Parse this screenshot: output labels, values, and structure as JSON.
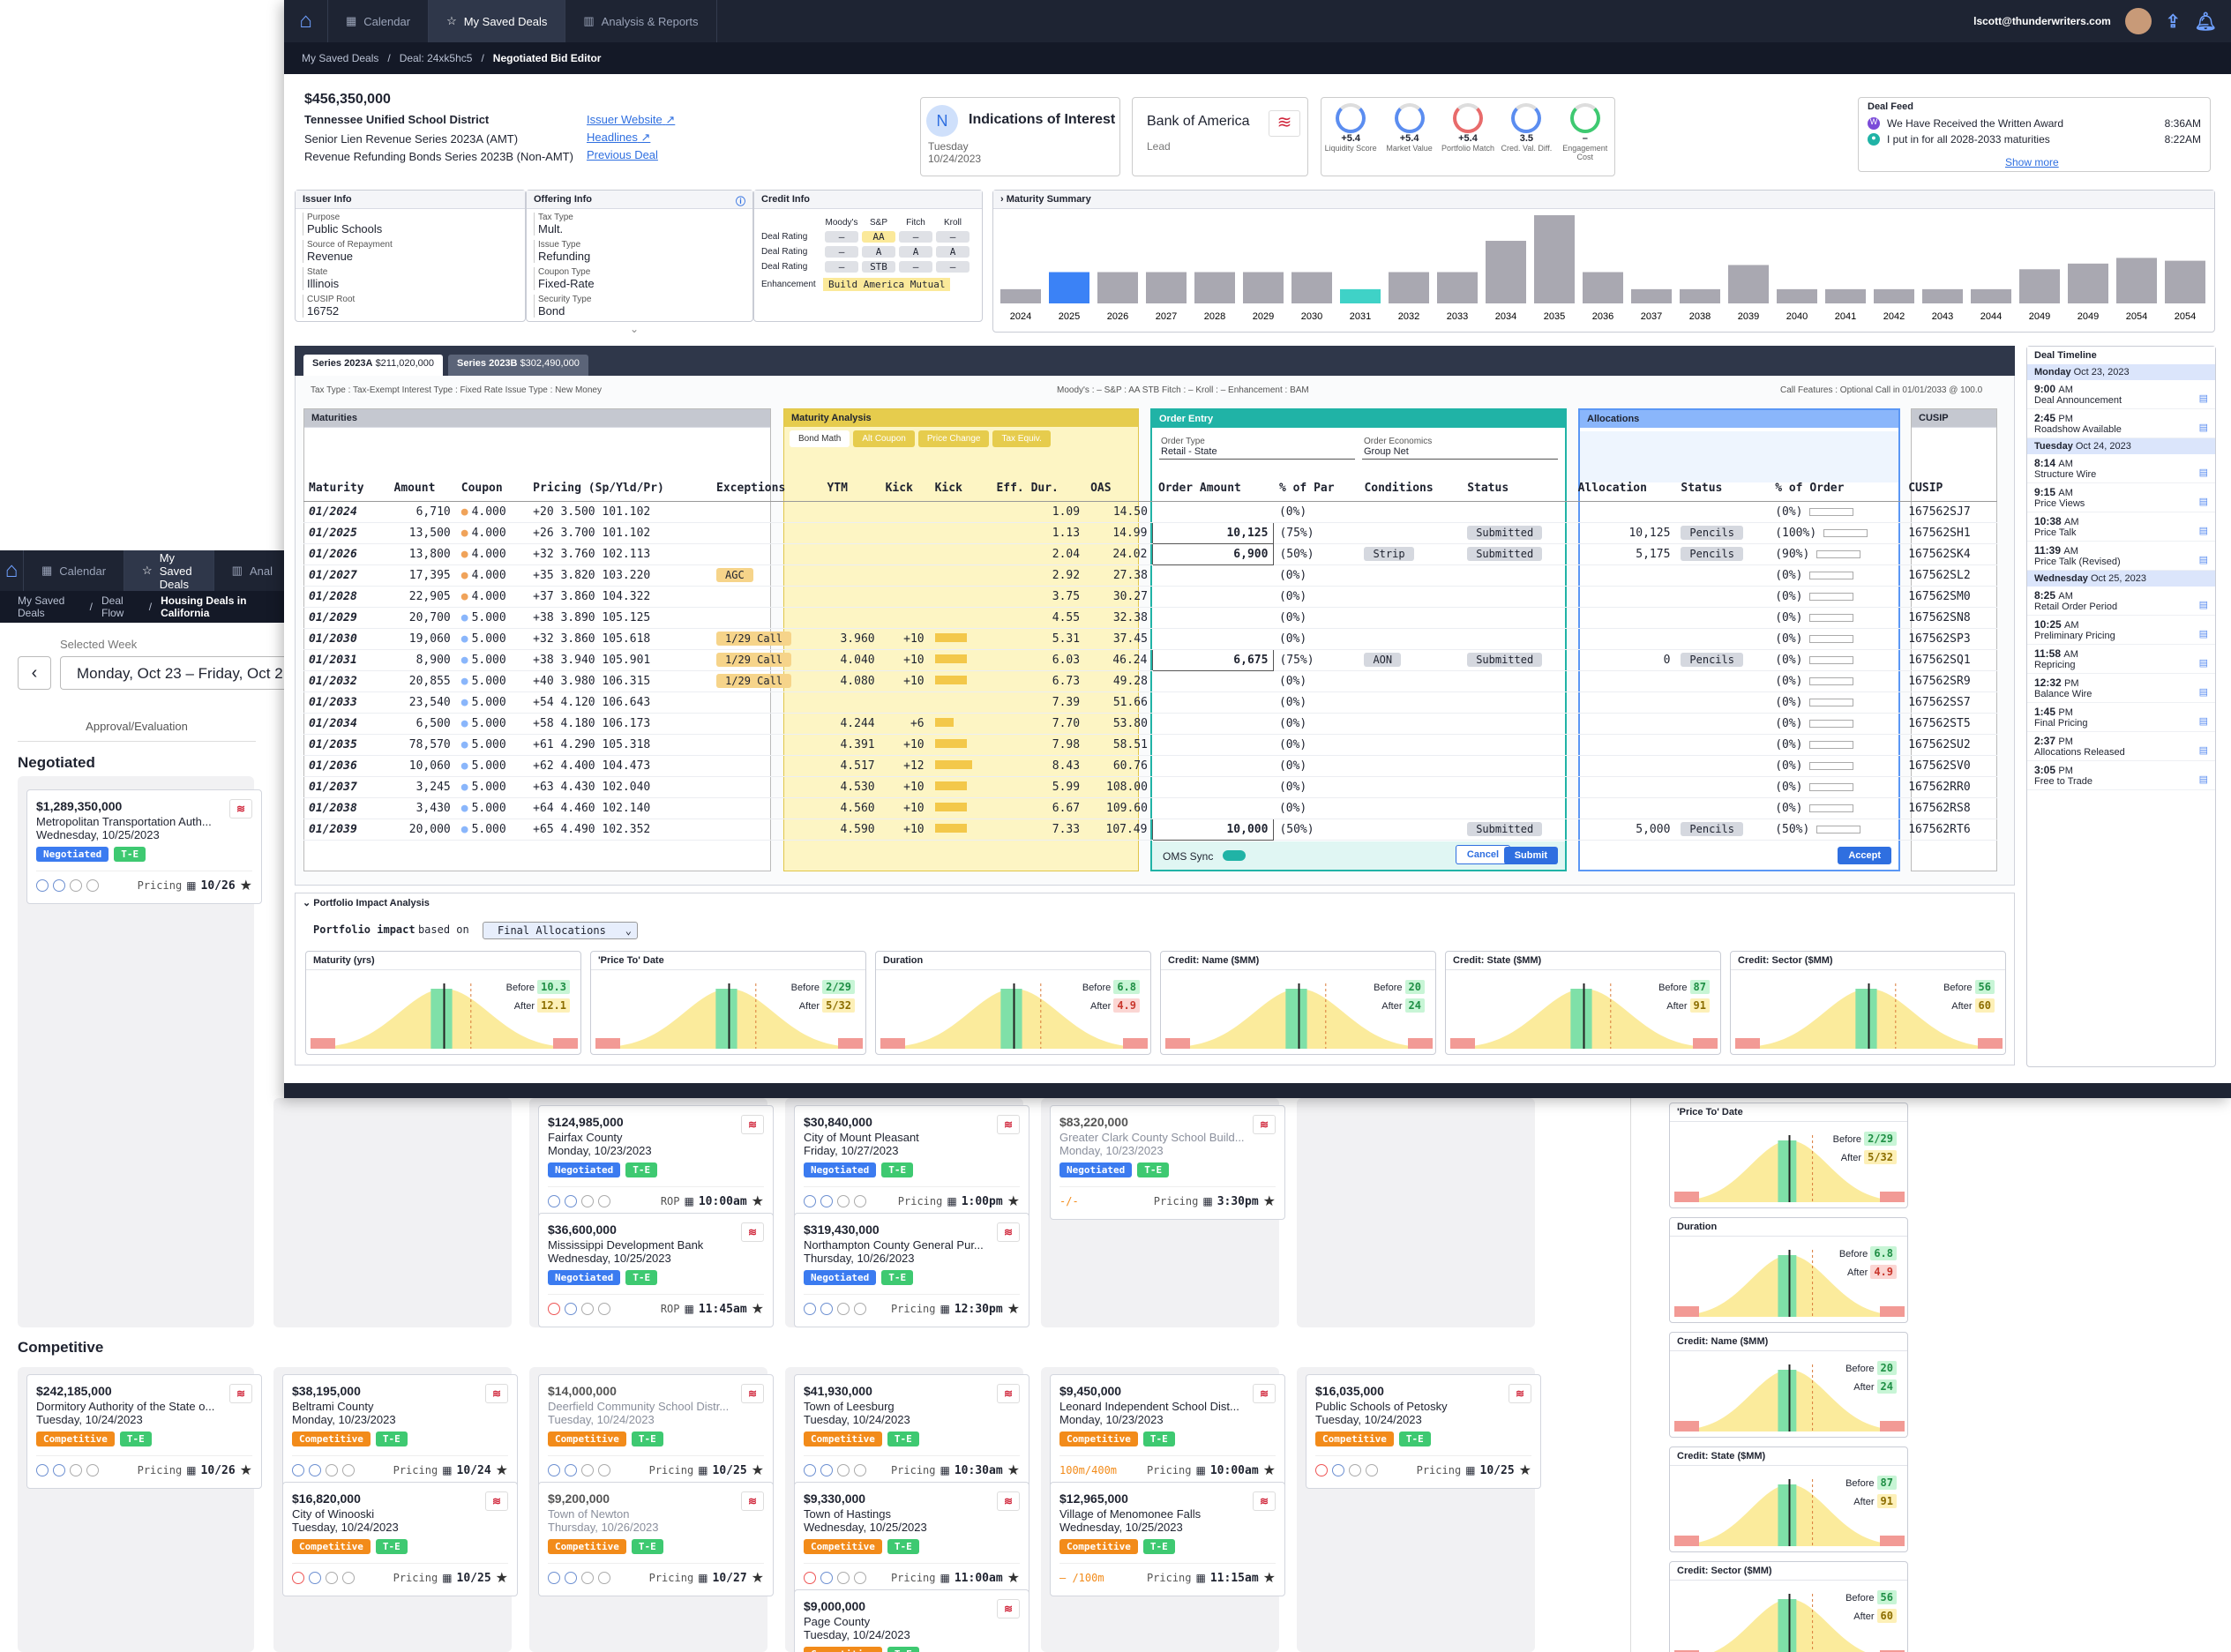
{
  "front": {
    "nav": {
      "tabs": [
        "Calendar",
        "My Saved Deals",
        "Analysis & Reports"
      ],
      "user": "lscott@thunderwriters.com"
    },
    "breadcrumb": [
      "My Saved Deals",
      "Deal: 24xk5hc5",
      "Negotiated Bid Editor"
    ],
    "deal": {
      "amount": "$456,350,000",
      "issuer": "Tennessee Unified School District",
      "series1": "Senior Lien Revenue Series 2023A (AMT)",
      "series2": "Revenue Refunding Bonds Series 2023B (Non-AMT)",
      "links": [
        "Issuer Website",
        "Headlines",
        "Previous Deal"
      ]
    },
    "ioi": {
      "letter": "N",
      "title": "Indications of Interest",
      "day": "Tuesday",
      "date": "10/24/2023"
    },
    "bank": {
      "name": "Bank of America",
      "role": "Lead"
    },
    "scores": [
      {
        "v": "+5.4",
        "l": "Liquidity Score"
      },
      {
        "v": "+5.4",
        "l": "Market Value"
      },
      {
        "v": "+5.4",
        "l": "Portfolio Match"
      },
      {
        "v": "3.5",
        "l": "Cred. Val. Diff."
      },
      {
        "v": "–",
        "l": "Engagement Cost"
      }
    ],
    "feed": {
      "title": "Deal Feed",
      "items": [
        {
          "t": "We Have Received the Written Award",
          "time": "8:36AM"
        },
        {
          "t": "I put in for all 2028-2033 maturities",
          "time": "8:22AM"
        }
      ],
      "more": "Show more"
    },
    "issuer_info": {
      "title": "Issuer Info",
      "fields": [
        {
          "k": "Purpose",
          "v": "Public Schools"
        },
        {
          "k": "Source of Repayment",
          "v": "Revenue"
        },
        {
          "k": "State",
          "v": "Illinois"
        },
        {
          "k": "CUSIP Root",
          "v": "16752"
        }
      ]
    },
    "offering_info": {
      "title": "Offering Info",
      "fields": [
        {
          "k": "Tax Type",
          "v": "Mult."
        },
        {
          "k": "Issue Type",
          "v": "Refunding"
        },
        {
          "k": "Coupon Type",
          "v": "Fixed-Rate"
        },
        {
          "k": "Security Type",
          "v": "Bond"
        }
      ]
    },
    "credit_info": {
      "title": "Credit Info",
      "cols": [
        "Moody's",
        "S&P",
        "Fitch",
        "Kroll"
      ],
      "rows": [
        {
          "l": "Deal Rating",
          "v": [
            "–",
            "AA",
            "–",
            "–"
          ]
        },
        {
          "l": "Deal Rating",
          "v": [
            "–",
            "A",
            "A",
            "A"
          ]
        },
        {
          "l": "Deal Rating",
          "v": [
            "–",
            "STB",
            "–",
            "–"
          ]
        }
      ],
      "enh_label": "Enhancement",
      "enh": "Build America Mutual"
    },
    "maturity_summary": {
      "title": "Maturity Summary",
      "years": [
        "2024",
        "2025",
        "2026",
        "2027",
        "2028",
        "2029",
        "2030",
        "2031",
        "2032",
        "2033",
        "2034",
        "2035",
        "2036",
        "2037",
        "2038",
        "2039",
        "2040",
        "2041",
        "2042",
        "2043",
        "2044",
        "2049",
        "2049",
        "2054",
        "2054"
      ],
      "values": [
        10,
        22,
        22,
        22,
        22,
        22,
        22,
        10,
        22,
        22,
        44,
        62,
        22,
        10,
        10,
        27,
        10,
        10,
        10,
        10,
        10,
        24,
        28,
        32,
        30
      ]
    },
    "series_tabs": [
      {
        "n": "Series 2023A",
        "a": "$211,020,000"
      },
      {
        "n": "Series 2023B",
        "a": "$302,490,000"
      }
    ],
    "series_meta": "Tax Type : Tax-Exempt   Interest Type : Fixed Rate   Issue Type : New Money",
    "series_meta2": "Moody's : –   S&P : AA STB   Fitch : –   Kroll : –   Enhancement : BAM",
    "call_features": "Call Features : Optional Call in 01/01/2033 @ 100.0",
    "sections": {
      "maturities": "Maturities",
      "analysis": "Maturity Analysis",
      "order": "Order Entry",
      "alloc": "Allocations",
      "cusip": "CUSIP"
    },
    "analysis_tabs": [
      "Bond Math",
      "Alt Coupon",
      "Price Change",
      "Tax Equiv."
    ],
    "order_type": {
      "label": "Order Type",
      "value": "Retail - State"
    },
    "order_econ": {
      "label": "Order Economics",
      "value": "Group Net"
    },
    "headers": [
      "Maturity",
      "Amount",
      "Coupon",
      "Pricing (Sp/Yld/Pr)",
      "Exceptions",
      "YTM",
      "Kick",
      "Kick",
      "Eff. Dur.",
      "OAS",
      "Order Amount",
      "% of Par",
      "Conditions",
      "Status",
      "Allocation",
      "Status",
      "% of Order",
      "CUSIP"
    ],
    "rows": [
      [
        "01/2024",
        "6,710",
        "4.000",
        "+20",
        "3.500",
        "101.102",
        "",
        "",
        "",
        "1.09",
        "14.50",
        "",
        "(0%)",
        "",
        "",
        "",
        "",
        "(0%)",
        "167562SJ7"
      ],
      [
        "01/2025",
        "13,500",
        "4.000",
        "+26",
        "3.700",
        "101.102",
        "",
        "",
        "",
        "1.13",
        "14.99",
        "10,125",
        "(75%)",
        "",
        "Submitted",
        "10,125",
        "Pencils",
        "(100%)",
        "167562SH1"
      ],
      [
        "01/2026",
        "13,800",
        "4.000",
        "+32",
        "3.760",
        "102.113",
        "",
        "",
        "",
        "2.04",
        "24.02",
        "6,900",
        "(50%)",
        "Strip",
        "Submitted",
        "5,175",
        "Pencils",
        "(90%)",
        "167562SK4"
      ],
      [
        "01/2027",
        "17,395",
        "4.000",
        "+35",
        "3.820",
        "103.220",
        "AGC",
        "",
        "",
        "2.92",
        "27.38",
        "",
        "(0%)",
        "",
        "",
        "",
        "",
        "(0%)",
        "167562SL2"
      ],
      [
        "01/2028",
        "22,905",
        "4.000",
        "+37",
        "3.860",
        "104.322",
        "",
        "",
        "",
        "3.75",
        "30.27",
        "",
        "(0%)",
        "",
        "",
        "",
        "",
        "(0%)",
        "167562SM0"
      ],
      [
        "01/2029",
        "20,700",
        "5.000",
        "+38",
        "3.890",
        "105.125",
        "",
        "",
        "",
        "4.55",
        "32.38",
        "",
        "(0%)",
        "",
        "",
        "",
        "",
        "(0%)",
        "167562SN8"
      ],
      [
        "01/2030",
        "19,060",
        "5.000",
        "+32",
        "3.860",
        "105.618",
        "1/29 Call",
        "3.960",
        "+10",
        "5.31",
        "37.45",
        "",
        "(0%)",
        "",
        "",
        "",
        "",
        "(0%)",
        "167562SP3"
      ],
      [
        "01/2031",
        "8,900",
        "5.000",
        "+38",
        "3.940",
        "105.901",
        "1/29 Call",
        "4.040",
        "+10",
        "6.03",
        "46.24",
        "6,675",
        "(75%)",
        "AON",
        "Submitted",
        "0",
        "Pencils",
        "(0%)",
        "167562SQ1"
      ],
      [
        "01/2032",
        "20,855",
        "5.000",
        "+40",
        "3.980",
        "106.315",
        "1/29 Call",
        "4.080",
        "+10",
        "6.73",
        "49.28",
        "",
        "(0%)",
        "",
        "",
        "",
        "",
        "(0%)",
        "167562SR9"
      ],
      [
        "01/2033",
        "23,540",
        "5.000",
        "+54",
        "4.120",
        "106.643",
        "",
        "",
        "",
        "7.39",
        "51.66",
        "",
        "(0%)",
        "",
        "",
        "",
        "",
        "(0%)",
        "167562SS7"
      ],
      [
        "01/2034",
        "6,500",
        "5.000",
        "+58",
        "4.180",
        "106.173",
        "",
        "4.244",
        "+6",
        "7.70",
        "53.80",
        "",
        "(0%)",
        "",
        "",
        "",
        "",
        "(0%)",
        "167562ST5"
      ],
      [
        "01/2035",
        "78,570",
        "5.000",
        "+61",
        "4.290",
        "105.318",
        "",
        "4.391",
        "+10",
        "7.98",
        "58.51",
        "",
        "(0%)",
        "",
        "",
        "",
        "",
        "(0%)",
        "167562SU2"
      ],
      [
        "01/2036",
        "10,060",
        "5.000",
        "+62",
        "4.400",
        "104.473",
        "",
        "4.517",
        "+12",
        "8.43",
        "60.76",
        "",
        "(0%)",
        "",
        "",
        "",
        "",
        "(0%)",
        "167562SV0"
      ],
      [
        "01/2037",
        "3,245",
        "5.000",
        "+63",
        "4.430",
        "102.040",
        "",
        "4.530",
        "+10",
        "5.99",
        "108.00",
        "",
        "(0%)",
        "",
        "",
        "",
        "",
        "(0%)",
        "167562RR0"
      ],
      [
        "01/2038",
        "3,430",
        "5.000",
        "+64",
        "4.460",
        "102.140",
        "",
        "4.560",
        "+10",
        "6.67",
        "109.60",
        "",
        "(0%)",
        "",
        "",
        "",
        "",
        "(0%)",
        "167562RS8"
      ],
      [
        "01/2039",
        "20,000",
        "5.000",
        "+65",
        "4.490",
        "102.352",
        "",
        "4.590",
        "+10",
        "7.33",
        "107.49",
        "10,000",
        "(50%)",
        "",
        "Submitted",
        "5,000",
        "Pencils",
        "(50%)",
        "167562RT6"
      ]
    ],
    "kick_bars": [
      0,
      0,
      0,
      0,
      0,
      0,
      0.6,
      0.6,
      0.6,
      0,
      0.35,
      0.6,
      0.7,
      0.6,
      0.6,
      0.6
    ],
    "oms": "OMS Sync",
    "cancel": "Cancel",
    "submit": "Submit",
    "accept": "Accept",
    "timeline": {
      "title": "Deal Timeline",
      "items": [
        {
          "day": "Monday",
          "date": "Oct 23, 2023"
        },
        {
          "time": "9:00",
          "ap": "AM",
          "t": "Deal Announcement"
        },
        {
          "time": "2:45",
          "ap": "PM",
          "t": "Roadshow Available"
        },
        {
          "day": "Tuesday",
          "date": "Oct 24, 2023"
        },
        {
          "time": "8:14",
          "ap": "AM",
          "t": "Structure Wire"
        },
        {
          "time": "9:15",
          "ap": "AM",
          "t": "Price Views"
        },
        {
          "time": "10:38",
          "ap": "AM",
          "t": "Price Talk"
        },
        {
          "time": "11:39",
          "ap": "AM",
          "t": "Price Talk (Revised)"
        },
        {
          "day": "Wednesday",
          "date": "Oct 25, 2023"
        },
        {
          "time": "8:25",
          "ap": "AM",
          "t": "Retail Order Period"
        },
        {
          "time": "10:25",
          "ap": "AM",
          "t": "Preliminary Pricing"
        },
        {
          "time": "11:58",
          "ap": "AM",
          "t": "Repricing"
        },
        {
          "time": "12:32",
          "ap": "PM",
          "t": "Balance Wire"
        },
        {
          "time": "1:45",
          "ap": "PM",
          "t": "Final Pricing"
        },
        {
          "time": "2:37",
          "ap": "PM",
          "t": "Allocations Released"
        },
        {
          "time": "3:05",
          "ap": "PM",
          "t": "Free to Trade"
        }
      ]
    },
    "impact": {
      "title": "Portfolio Impact Analysis",
      "label": "Portfolio impact",
      "based": "based on",
      "select": "Final Allocations",
      "before": "Before",
      "after": "After",
      "charts": [
        {
          "t": "Maturity (yrs)",
          "b": "10.3",
          "a": "12.1",
          "ac": "y"
        },
        {
          "t": "'Price To' Date",
          "b": "2/29",
          "a": "5/32",
          "ac": "y"
        },
        {
          "t": "Duration",
          "b": "6.8",
          "a": "4.9",
          "ac": "r"
        },
        {
          "t": "Credit: Name ($MM)",
          "b": "20",
          "a": "24",
          "ac": "g"
        },
        {
          "t": "Credit: State ($MM)",
          "b": "87",
          "a": "91",
          "ac": "y"
        },
        {
          "t": "Credit: Sector ($MM)",
          "b": "56",
          "a": "60",
          "ac": "y"
        }
      ]
    }
  },
  "back": {
    "nav": {
      "tabs": [
        "Calendar",
        "My Saved Deals",
        "Anal"
      ]
    },
    "breadcrumb": [
      "My Saved Deals",
      "Deal Flow",
      "Housing Deals in California"
    ],
    "week_label": "Selected Week",
    "week": "Monday, Oct 23 – Friday, Oct 2",
    "stage": "Approval/Evaluation",
    "neg": "Negotiated",
    "comp": "Competitive",
    "neg_cards": [
      {
        "amt": "$1,289,350,000",
        "iss": "Metropolitan Transportation Auth...",
        "date": "Wednesday, 10/25/2023",
        "lbl": "Pricing",
        "val": "10/26"
      },
      {
        "amt": "$124,985,000",
        "iss": "Fairfax County",
        "date": "Monday, 10/23/2023",
        "lbl": "ROP",
        "val": "10:00am"
      },
      {
        "amt": "$36,600,000",
        "iss": "Mississippi Development Bank",
        "date": "Wednesday, 10/25/2023",
        "lbl": "ROP",
        "val": "11:45am"
      },
      {
        "amt": "$30,840,000",
        "iss": "City of Mount Pleasant",
        "date": "Friday, 10/27/2023",
        "lbl": "Pricing",
        "val": "1:00pm"
      },
      {
        "amt": "$319,430,000",
        "iss": "Northampton County General Pur...",
        "date": "Thursday, 10/26/2023",
        "lbl": "Pricing",
        "val": "12:30pm"
      },
      {
        "amt": "$83,220,000",
        "iss": "Greater Clark County School Build...",
        "date": "Monday, 10/23/2023",
        "lbl": "Pricing",
        "val": "3:30pm",
        "pre": "-/-"
      }
    ],
    "comp_cards": [
      {
        "amt": "$242,185,000",
        "iss": "Dormitory Authority of the State o...",
        "date": "Tuesday, 10/24/2023",
        "lbl": "Pricing",
        "val": "10/26"
      },
      {
        "amt": "$38,195,000",
        "iss": "Beltrami County",
        "date": "Monday, 10/23/2023",
        "lbl": "Pricing",
        "val": "10/24"
      },
      {
        "amt": "$16,820,000",
        "iss": "City of Winooski",
        "date": "Tuesday, 10/24/2023",
        "lbl": "Pricing",
        "val": "10/25"
      },
      {
        "amt": "$14,000,000",
        "iss": "Deerfield Community School Distr...",
        "date": "Tuesday, 10/24/2023",
        "lbl": "Pricing",
        "val": "10/25"
      },
      {
        "amt": "$9,200,000",
        "iss": "Town of Newton",
        "date": "Thursday, 10/26/2023",
        "lbl": "Pricing",
        "val": "10/27"
      },
      {
        "amt": "$41,930,000",
        "iss": "Town of Leesburg",
        "date": "Tuesday, 10/24/2023",
        "lbl": "Pricing",
        "val": "10:30am"
      },
      {
        "amt": "$9,330,000",
        "iss": "Town of Hastings",
        "date": "Wednesday, 10/25/2023",
        "lbl": "Pricing",
        "val": "11:00am"
      },
      {
        "amt": "$9,000,000",
        "iss": "Page County",
        "date": "Tuesday, 10/24/2023",
        "lbl": "",
        "val": ""
      },
      {
        "amt": "$9,450,000",
        "iss": "Leonard Independent School Dist...",
        "date": "Monday, 10/23/2023",
        "lbl": "Pricing",
        "val": "10:00am",
        "pre": "100m/400m"
      },
      {
        "amt": "$12,965,000",
        "iss": "Village of Menomonee Falls",
        "date": "Wednesday, 10/25/2023",
        "lbl": "Pricing",
        "val": "11:15am",
        "pre": "– /100m"
      },
      {
        "amt": "$16,035,000",
        "iss": "Public Schools of Petosky",
        "date": "Tuesday, 10/24/2023",
        "lbl": "Pricing",
        "val": "10/25"
      }
    ],
    "badges": {
      "neg": "Negotiated",
      "comp": "Competitive",
      "te": "T-E"
    },
    "side_charts": [
      {
        "t": "'Price To' Date",
        "b": "2/29",
        "a": "5/32",
        "ac": "y"
      },
      {
        "t": "Duration",
        "b": "6.8",
        "a": "4.9",
        "ac": "r"
      },
      {
        "t": "Credit: Name ($MM)",
        "b": "20",
        "a": "24",
        "ac": "g"
      },
      {
        "t": "Credit: State ($MM)",
        "b": "87",
        "a": "91",
        "ac": "y"
      },
      {
        "t": "Credit: Sector ($MM)",
        "b": "56",
        "a": "60",
        "ac": "y"
      }
    ]
  }
}
